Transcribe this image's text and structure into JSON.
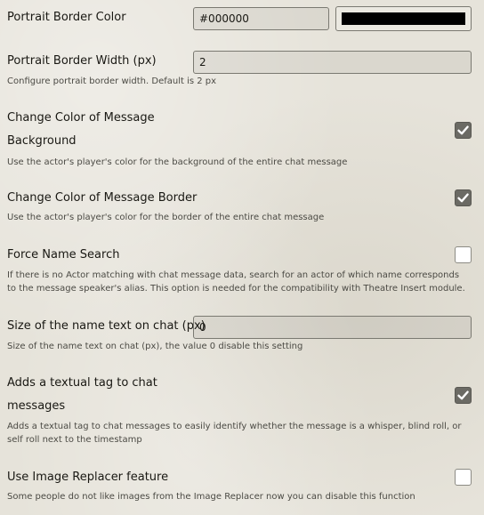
{
  "colors": {
    "portrait_border": "#000000"
  },
  "settings": [
    {
      "label": "Portrait Border Color",
      "value": "#000000"
    },
    {
      "label": "Portrait Border Width (px)",
      "value": "2",
      "hint": "Configure portrait border width. Default is 2 px"
    },
    {
      "label_line1": "Change Color of Message",
      "label_line2": "Background",
      "checked": true,
      "hint": "Use the actor's player's color for the background of the entire chat message"
    },
    {
      "label": "Change Color of Message Border",
      "checked": true,
      "hint": "Use the actor's player's color for the border of the entire chat message"
    },
    {
      "label": "Force Name Search",
      "checked": false,
      "hint_line1": "If there is no Actor matching with chat message data, search for an actor of which name corresponds",
      "hint_line2": "to the message speaker's alias. This option is needed for the compatibility with Theatre Insert module."
    },
    {
      "label": "Size of the name text on chat (px)",
      "value": "0",
      "hint": "Size of the name text on chat (px), the value 0 disable this setting"
    },
    {
      "label_line1": "Adds a textual tag to chat",
      "label_line2": "messages",
      "checked": true,
      "hint_line1": "Adds a textual tag to chat messages to easily identify whether the message is a whisper, blind roll, or",
      "hint_line2": "self roll next to the timestamp"
    },
    {
      "label": "Use Image Replacer feature",
      "checked": false,
      "hint": "Some people do not like images from the Image Replacer now you can disable this function"
    }
  ]
}
